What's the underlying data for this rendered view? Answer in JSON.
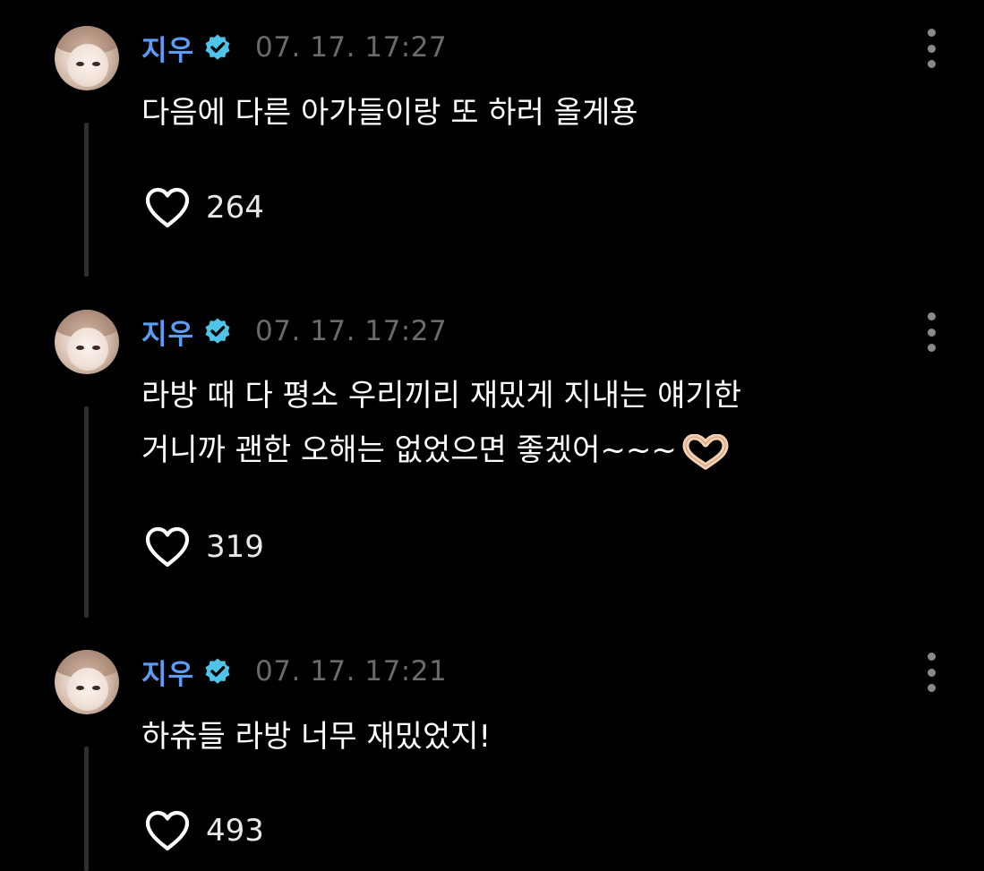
{
  "accent_color": "#5b9df5",
  "verified_color": "#4fc3e8",
  "comments": [
    {
      "username": "지우",
      "verified": true,
      "timestamp": "07. 17. 17:27",
      "text_lines": [
        "다음에 다른 아가들이랑 또 하러 올게용"
      ],
      "likes": "264",
      "icons": {
        "like": "heart-outline-icon",
        "more": "more-vertical-icon",
        "badge": "verified-badge-icon"
      }
    },
    {
      "username": "지우",
      "verified": true,
      "timestamp": "07. 17. 17:27",
      "text_lines": [
        "라방 때 다 평소 우리끼리 재밌게 지내는 얘기한",
        "거니까 괜한 오해는 없었으면 좋겠어~~~"
      ],
      "trailing_emoji": "heart-hands-emoji",
      "likes": "319",
      "icons": {
        "like": "heart-outline-icon",
        "more": "more-vertical-icon",
        "badge": "verified-badge-icon"
      }
    },
    {
      "username": "지우",
      "verified": true,
      "timestamp": "07. 17. 17:21",
      "text_lines": [
        "하츄들 라방 너무 재밌었지!"
      ],
      "likes": "493",
      "icons": {
        "like": "heart-outline-icon",
        "more": "more-vertical-icon",
        "badge": "verified-badge-icon"
      }
    }
  ]
}
